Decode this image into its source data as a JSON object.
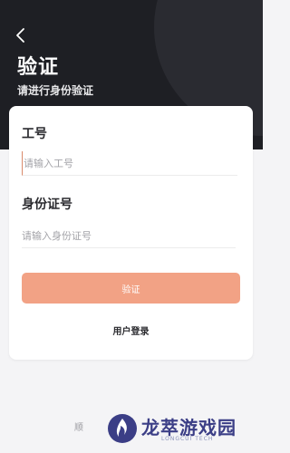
{
  "header": {
    "title": "验证",
    "subtitle": "请进行身份验证"
  },
  "form": {
    "employee_id_label": "工号",
    "employee_id_placeholder": "请输入工号",
    "id_number_label": "身份证号",
    "id_number_placeholder": "请输入身份证号",
    "submit_label": "验证",
    "user_login_label": "用户登录"
  },
  "footer": {
    "partial_text": "顺"
  },
  "watermark": {
    "chinese": "龙萃游戏园",
    "english": "LONGCUI TECH"
  },
  "colors": {
    "header_bg": "#1e1f24",
    "accent_button": "#f2a285",
    "watermark_blue": "#3b3e86"
  },
  "icons": {
    "back": "chevron-left-icon",
    "watermark": "flame-logo-icon"
  }
}
